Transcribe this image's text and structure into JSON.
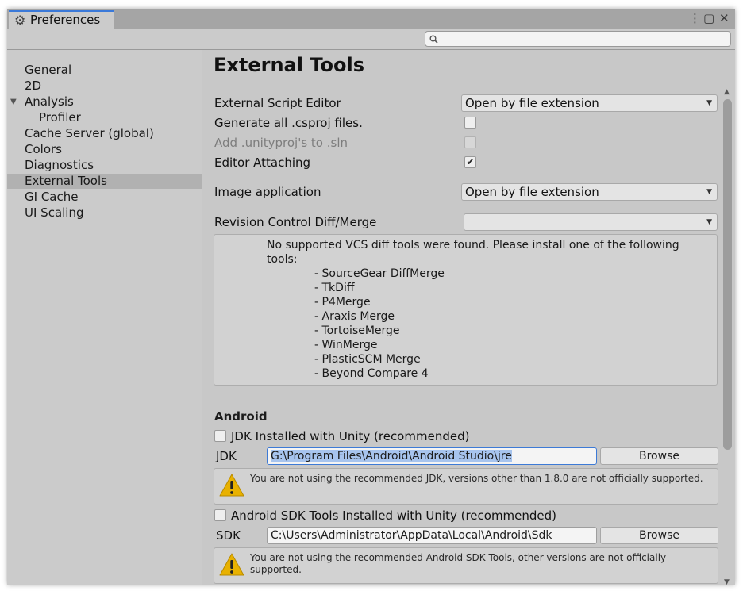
{
  "window": {
    "tab_title": "Preferences",
    "tab_icon": "gear-icon",
    "controls": [
      "⋮",
      "▢",
      "✕"
    ]
  },
  "search": {
    "placeholder": "",
    "icon": "search-icon"
  },
  "sidebar": {
    "items": [
      {
        "label": "General"
      },
      {
        "label": "2D"
      },
      {
        "label": "Analysis",
        "expanded": true
      },
      {
        "label": "Profiler",
        "child": true
      },
      {
        "label": "Cache Server (global)"
      },
      {
        "label": "Colors"
      },
      {
        "label": "Diagnostics"
      },
      {
        "label": "External Tools",
        "selected": true
      },
      {
        "label": "GI Cache"
      },
      {
        "label": "UI Scaling"
      }
    ]
  },
  "main": {
    "title": "External Tools",
    "script_editor": {
      "label": "External Script Editor",
      "value": "Open by file extension"
    },
    "gen_csproj": {
      "label": "Generate all .csproj files.",
      "checked": false
    },
    "add_unityproj": {
      "label": "Add .unityproj's to .sln",
      "checked": false,
      "disabled": true
    },
    "editor_attaching": {
      "label": "Editor Attaching",
      "checked": true,
      "mark": "✔"
    },
    "image_app": {
      "label": "Image application",
      "value": "Open by file extension"
    },
    "revision": {
      "label": "Revision Control Diff/Merge",
      "value": ""
    },
    "vcs": {
      "message": "No supported VCS diff tools were found. Please install one of the following tools:",
      "tools": [
        "- SourceGear DiffMerge",
        "- TkDiff",
        "- P4Merge",
        "- Araxis Merge",
        "- TortoiseMerge",
        "- WinMerge",
        "- PlasticSCM Merge",
        "- Beyond Compare 4"
      ]
    },
    "android": {
      "heading": "Android",
      "jdk_installed": {
        "label": "JDK Installed with Unity (recommended)",
        "checked": false
      },
      "jdk": {
        "label": "JDK",
        "path": "G:\\Program Files\\Android\\Android Studio\\jre",
        "browse": "Browse"
      },
      "jdk_warning": "You are not using the recommended JDK, versions other than 1.8.0 are not officially supported.",
      "sdk_installed": {
        "label": "Android SDK Tools Installed with Unity (recommended)",
        "checked": false
      },
      "sdk": {
        "label": "SDK",
        "path": "C:\\Users\\Administrator\\AppData\\Local\\Android\\Sdk",
        "browse": "Browse"
      },
      "sdk_warning": "You are not using the recommended Android SDK Tools, other versions are not officially supported."
    }
  },
  "colors": {
    "accent": "#3a79d9",
    "selection": "#b1b1b1",
    "warning": "#e8b100"
  }
}
